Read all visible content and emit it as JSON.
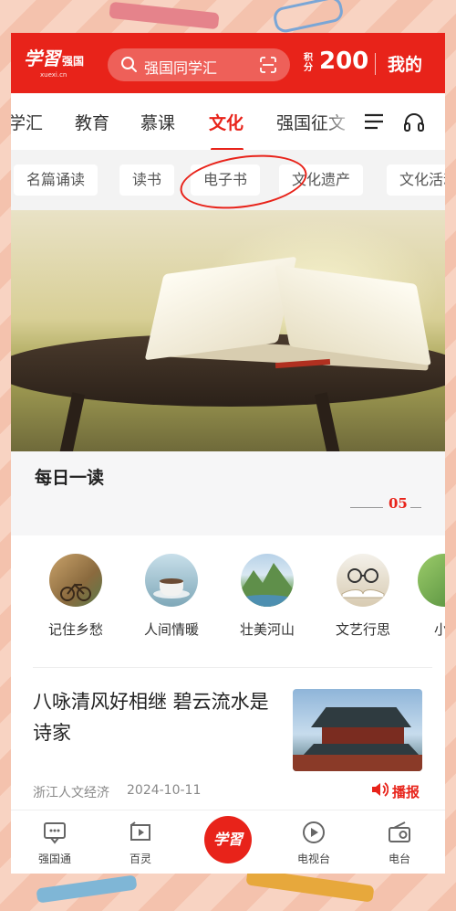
{
  "app": {
    "logo_main": "学習",
    "logo_side": "强国",
    "logo_sub": "xuexi.cn",
    "brand_color": "#e8231a"
  },
  "header": {
    "search_placeholder": "强国同学汇",
    "points_label": "积分",
    "points_value": "200",
    "mine_label": "我的"
  },
  "tabs": [
    {
      "label": "学汇"
    },
    {
      "label": "教育"
    },
    {
      "label": "慕课"
    },
    {
      "label": "文化",
      "active": true
    },
    {
      "label": "强国征文"
    }
  ],
  "subtabs": [
    {
      "label": "名篇诵读"
    },
    {
      "label": "读书"
    },
    {
      "label": "电子书"
    },
    {
      "label": "文化遗产"
    },
    {
      "label": "文化活动"
    }
  ],
  "daily": {
    "title": "每日一读",
    "page": "05"
  },
  "categories": [
    {
      "label": "记住乡愁",
      "icon": "bicycle-alley-image"
    },
    {
      "label": "人间情暖",
      "icon": "coffee-cup-image"
    },
    {
      "label": "壮美河山",
      "icon": "mountain-river-image"
    },
    {
      "label": "文艺行思",
      "icon": "glasses-book-image"
    },
    {
      "label": "小"
    }
  ],
  "article": {
    "title": "八咏清风好相继 碧云流水是诗家",
    "source": "浙江人文经济",
    "date": "2024-10-11",
    "play_label": "播报"
  },
  "bottom_nav": [
    {
      "label": "强国通",
      "icon": "chat-icon"
    },
    {
      "label": "百灵",
      "icon": "play-box-icon"
    },
    {
      "label": "学習",
      "icon": "center-logo"
    },
    {
      "label": "电视台",
      "icon": "tv-play-icon"
    },
    {
      "label": "电台",
      "icon": "radio-icon"
    }
  ]
}
